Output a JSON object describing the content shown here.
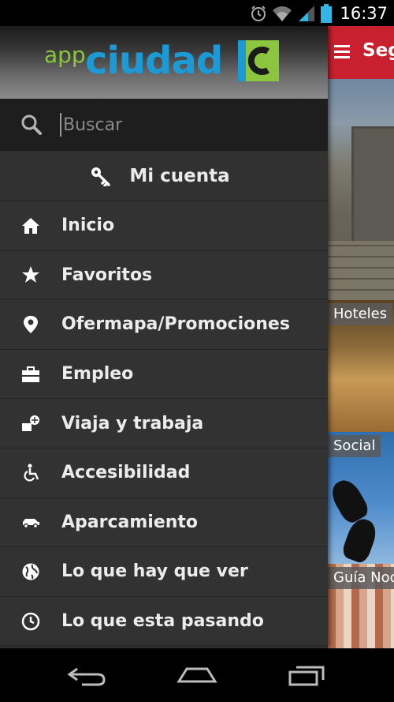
{
  "status_bar": {
    "time": "16:37",
    "icons": [
      "alarm-icon",
      "wifi-icon",
      "signal-icon",
      "battery-icon"
    ]
  },
  "background_app": {
    "title": "Seg",
    "tiles": [
      {
        "label": ""
      },
      {
        "label": "Hoteles"
      },
      {
        "label": "Social"
      },
      {
        "label": "Guía Noc"
      }
    ],
    "header_color": "#c8202e"
  },
  "drawer": {
    "logo": {
      "app": "app",
      "ciudad": "ciudad"
    },
    "search": {
      "placeholder": "Buscar",
      "value": ""
    },
    "account": {
      "label": "Mi cuenta",
      "icon": "key-icon"
    },
    "items": [
      {
        "label": "Inicio",
        "icon": "home-icon"
      },
      {
        "label": "Favoritos",
        "icon": "star-icon"
      },
      {
        "label": "Ofermapa/Promociones",
        "icon": "location-pin-icon"
      },
      {
        "label": "Empleo",
        "icon": "briefcase-icon"
      },
      {
        "label": "Viaja y trabaja",
        "icon": "travel-work-icon"
      },
      {
        "label": "Accesibilidad",
        "icon": "wheelchair-icon"
      },
      {
        "label": "Aparcamiento",
        "icon": "car-icon"
      },
      {
        "label": "Lo que hay que ver",
        "icon": "globe-icon"
      },
      {
        "label": "Lo que esta pasando",
        "icon": "clock-icon"
      }
    ],
    "colors": {
      "app_green": "#8cc63f",
      "ciudad_blue": "#1b9ad6"
    }
  },
  "nav_bar": {
    "buttons": [
      "back-icon",
      "home-icon",
      "recent-apps-icon"
    ]
  }
}
